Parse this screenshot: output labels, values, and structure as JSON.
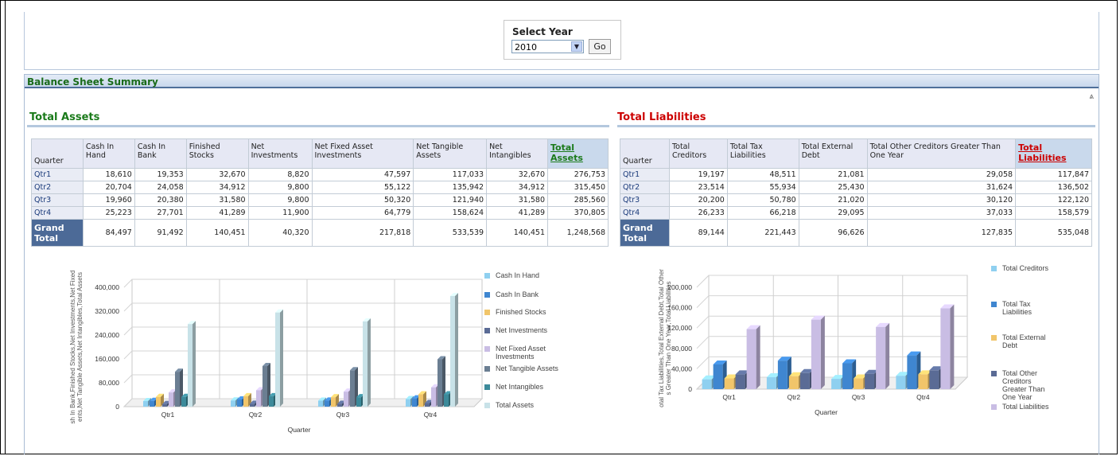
{
  "selector": {
    "label": "Select Year",
    "year": "2010",
    "go_label": "Go",
    "arrow_icon": "chevron-down-icon"
  },
  "panel": {
    "title": "Balance Sheet Summary",
    "collapse_icon": "double-chevron-up-icon"
  },
  "assets": {
    "title": "Total Assets",
    "quarter_label": "Quarter",
    "columns": [
      "Cash In Hand",
      "Cash In Bank",
      "Finished Stocks",
      "Net Investments",
      "Net Fixed Asset Investments",
      "Net Tangible Assets",
      "Net Intangibles",
      "Total Assets"
    ],
    "rows": [
      {
        "q": "Qtr1",
        "v": [
          "18,610",
          "19,353",
          "32,670",
          "8,820",
          "47,597",
          "117,033",
          "32,670",
          "276,753"
        ]
      },
      {
        "q": "Qtr2",
        "v": [
          "20,704",
          "24,058",
          "34,912",
          "9,800",
          "55,122",
          "135,942",
          "34,912",
          "315,450"
        ]
      },
      {
        "q": "Qtr3",
        "v": [
          "19,960",
          "20,380",
          "31,580",
          "9,800",
          "50,320",
          "121,940",
          "31,580",
          "285,560"
        ]
      },
      {
        "q": "Qtr4",
        "v": [
          "25,223",
          "27,701",
          "41,289",
          "11,900",
          "64,779",
          "158,624",
          "41,289",
          "370,805"
        ]
      }
    ],
    "grand_total_label": "Grand Total",
    "grand_total": [
      "84,497",
      "91,492",
      "140,451",
      "40,320",
      "217,818",
      "533,539",
      "140,451",
      "1,248,568"
    ],
    "title_color": "#1a7a1a"
  },
  "liabilities": {
    "title": "Total Liabilities",
    "quarter_label": "Quarter",
    "columns": [
      "Total Creditors",
      "Total Tax Liabilities",
      "Total External Debt",
      "Total Other Creditors Greater Than One Year",
      "Total Liabilities"
    ],
    "rows": [
      {
        "q": "Qtr1",
        "v": [
          "19,197",
          "48,511",
          "21,081",
          "29,058",
          "117,847"
        ]
      },
      {
        "q": "Qtr2",
        "v": [
          "23,514",
          "55,934",
          "25,430",
          "31,624",
          "136,502"
        ]
      },
      {
        "q": "Qtr3",
        "v": [
          "20,200",
          "50,780",
          "21,020",
          "30,120",
          "122,120"
        ]
      },
      {
        "q": "Qtr4",
        "v": [
          "26,233",
          "66,218",
          "29,095",
          "37,033",
          "158,579"
        ]
      }
    ],
    "grand_total_label": "Grand Total",
    "grand_total": [
      "89,144",
      "221,443",
      "96,626",
      "127,835",
      "535,048"
    ],
    "title_color": "#cc0000"
  },
  "chart_data": [
    {
      "type": "bar",
      "xlabel": "Quarter",
      "ylabel": "...sh In Bank,Finished Stocks,Net Investments,Net Fixed ...ents,Net Tangible Assets,Net Intangibles,Total Assets",
      "ylim": [
        0,
        400000
      ],
      "yticks": [
        "0",
        "80,000",
        "160,000",
        "240,000",
        "320,000",
        "400,000"
      ],
      "categories": [
        "Qtr1",
        "Qtr2",
        "Qtr3",
        "Qtr4"
      ],
      "legend_position": "right",
      "series": [
        {
          "name": "Cash In Hand",
          "color": "#8fd0f0",
          "values": [
            18610,
            20704,
            19960,
            25223
          ]
        },
        {
          "name": "Cash In Bank",
          "color": "#3f86d0",
          "values": [
            19353,
            24058,
            20380,
            27701
          ]
        },
        {
          "name": "Finished Stocks",
          "color": "#f1c56a",
          "values": [
            32670,
            34912,
            31580,
            41289
          ]
        },
        {
          "name": "Net Investments",
          "color": "#5a6b95",
          "values": [
            8820,
            9800,
            9800,
            11900
          ]
        },
        {
          "name": "Net Fixed Asset Investments",
          "color": "#c9bde4",
          "values": [
            47597,
            55122,
            50320,
            64779
          ]
        },
        {
          "name": "Net Tangible Assets",
          "color": "#6b7e92",
          "values": [
            117033,
            135942,
            121940,
            158624
          ]
        },
        {
          "name": "Net Intangibles",
          "color": "#3c8a9a",
          "values": [
            32670,
            34912,
            31580,
            41289
          ]
        },
        {
          "name": "Total Assets",
          "color": "#c8e2e8",
          "values": [
            276753,
            315450,
            285560,
            370805
          ]
        }
      ]
    },
    {
      "type": "bar",
      "xlabel": "Quarter",
      "ylabel": "...otal Tax Liabilities,Total External Debt,Total Other ...s Greater Than One Year,Total Liabilities",
      "ylim": [
        0,
        200000
      ],
      "yticks": [
        "0",
        "40,000",
        "80,000",
        "120,000",
        "160,000",
        "200,000"
      ],
      "categories": [
        "Qtr1",
        "Qtr2",
        "Qtr3",
        "Qtr4"
      ],
      "legend_position": "right",
      "series": [
        {
          "name": "Total Creditors",
          "color": "#8fd0f0",
          "values": [
            19197,
            23514,
            20200,
            26233
          ]
        },
        {
          "name": "Total Tax Liabilities",
          "color": "#3f86d0",
          "values": [
            48511,
            55934,
            50780,
            66218
          ]
        },
        {
          "name": "Total External Debt",
          "color": "#f1c56a",
          "values": [
            21081,
            25430,
            21020,
            29095
          ]
        },
        {
          "name": "Total Other Creditors Greater Than One Year",
          "color": "#5a6b95",
          "values": [
            29058,
            31624,
            30120,
            37033
          ]
        },
        {
          "name": "Total Liabilities",
          "color": "#c9bde4",
          "values": [
            117847,
            136502,
            122120,
            158579
          ]
        }
      ]
    }
  ]
}
